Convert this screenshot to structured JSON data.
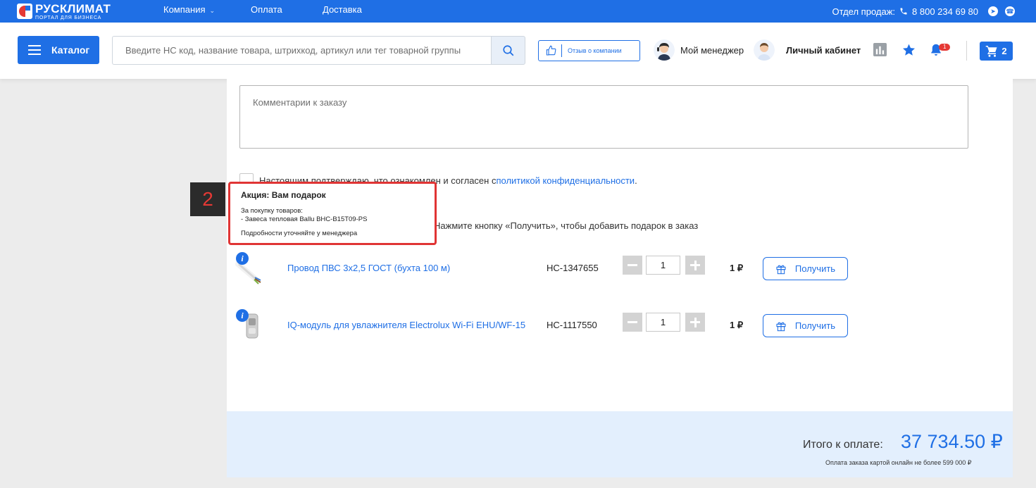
{
  "topbar": {
    "logo_title": "РУСКЛИМАТ",
    "logo_subtitle": "ПОРТАЛ ДЛЯ БИЗНЕСА",
    "nav": [
      "Компания",
      "Оплата",
      "Доставка"
    ],
    "sales_label": "Отдел продаж:",
    "phone": "8 800 234 69 80"
  },
  "header": {
    "catalog_label": "Каталог",
    "search_placeholder": "Введите НС код, название товара, штрихкод, артикул или тег товарной группы",
    "review_label": "Отзыв о компании",
    "manager_label": "Мой менеджер",
    "account_label": "Личный кабинет",
    "notifications_count": "1",
    "cart_count": "2"
  },
  "order": {
    "comment_placeholder": "Комментарии к заказу",
    "consent_text": "Настоящим подтверждаю, что ознакомлен и согласен с ",
    "consent_link": "политикой конфиденциальности",
    "consent_end": ".",
    "gift_hint": "Нажмите кнопку «Получить», чтобы добавить подарок в заказ",
    "items": [
      {
        "name": "Провод ПВС 3х2,5 ГОСТ (бухта 100 м)",
        "code": "НС-1347655",
        "qty": "1",
        "price": "1 ₽",
        "button": "Получить"
      },
      {
        "name": "IQ-модуль для увлажнителя Electrolux Wi-Fi EHU/WF-15",
        "code": "НС-1117550",
        "qty": "1",
        "price": "1 ₽",
        "button": "Получить"
      }
    ]
  },
  "tooltip": {
    "step": "2",
    "title": "Акция: Вам подарок",
    "line1": "За покупку товаров:",
    "line2": "- Завеса тепловая Ballu BHC-B15T09-PS",
    "footer": "Подробности уточняйте у менеджера"
  },
  "total": {
    "label": "Итого к оплате:",
    "value": "37 734.50 ₽",
    "note": "Оплата заказа картой онлайн не более 599 000 ₽"
  },
  "colors": {
    "brand": "#1f6fe5",
    "alert": "#e53935"
  }
}
